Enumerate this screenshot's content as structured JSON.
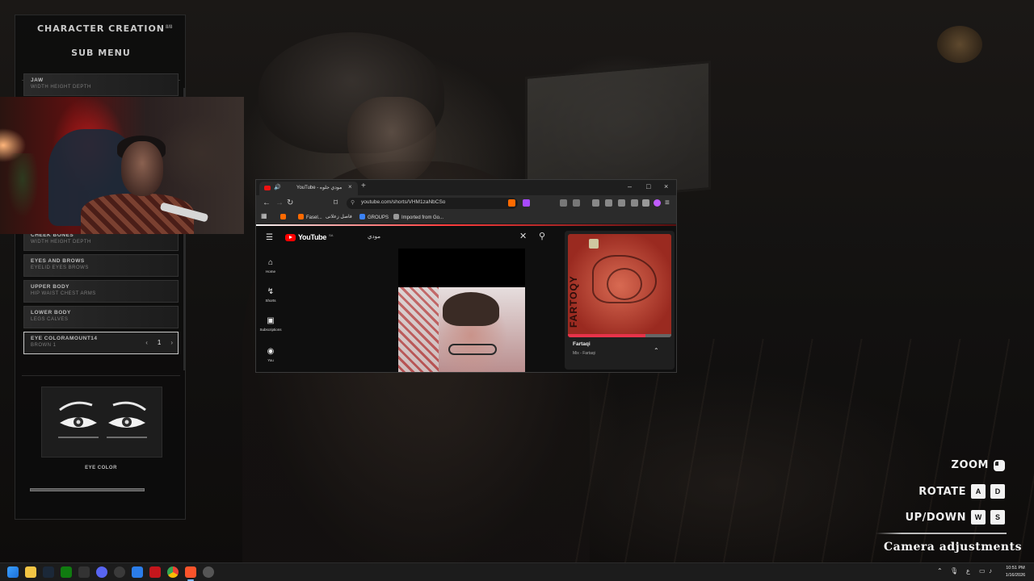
{
  "panel": {
    "title": "CHARACTER CREATION",
    "page": "8/8",
    "subtitle": "SUB MENU",
    "items": [
      {
        "title": "JAW",
        "sub": "WIDTH HEIGHT DEPTH"
      },
      {
        "title": "CHEEK BONES",
        "sub": "WIDTH HEIGHT DEPTH"
      },
      {
        "title": "EYES AND BROWS",
        "sub": "EYELID EYES BROWS"
      },
      {
        "title": "UPPER BODY",
        "sub": "HIP WAIST CHEST ARMS"
      },
      {
        "title": "LOWER BODY",
        "sub": "LEGS CALVES"
      },
      {
        "title": "EYE COLORAMOUNT14",
        "sub": "BROWN 1"
      }
    ],
    "stepper": {
      "prev": "‹",
      "value": "1",
      "next": "›"
    },
    "preview_label": "EYE COLOR"
  },
  "browser": {
    "tab_title": "YouTube - مودي جلوه",
    "tab_close": "×",
    "new_tab": "+",
    "window_controls": [
      "–",
      "□",
      "×"
    ],
    "url": "youtube.com/shorts/VHM1zaNbCSo",
    "bookmarks": [
      {
        "label": "Fasel...",
        "color": "#ff6a00"
      },
      {
        "label": "فاصل زعلانى",
        "color": "#888"
      },
      {
        "label": "GROUPS",
        "color": "#3b82f6"
      },
      {
        "label": "Imported from Go...",
        "color": "#999"
      }
    ],
    "youtube": {
      "logo": "YouTube",
      "country": "SA",
      "search_query": "مودي",
      "nav": [
        {
          "label": "Home",
          "icon": "⌂"
        },
        {
          "label": "Shorts",
          "icon": "↯"
        },
        {
          "label": "Subscriptions",
          "icon": "▣"
        },
        {
          "label": "You",
          "icon": "◉"
        }
      ],
      "mix": {
        "cover_text": "FARTOQY",
        "title": "Fartaqi",
        "subtitle": "Mix - Fartaqi"
      }
    }
  },
  "controls": {
    "zoom": "ZOOM",
    "rotate": "ROTATE",
    "rotate_keys": [
      "A",
      "D"
    ],
    "updown": "UP/DOWN",
    "updown_keys": [
      "W",
      "S"
    ],
    "camera": "Camera adjustments"
  },
  "taskbar": {
    "time": "10:51 PM",
    "date": "1/16/2026"
  }
}
